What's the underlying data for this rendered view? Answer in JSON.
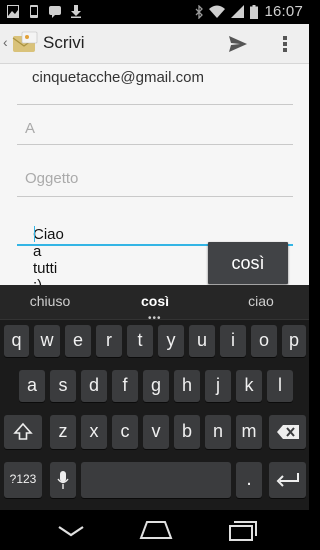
{
  "status_bar": {
    "time": "16:07"
  },
  "action_bar": {
    "title": "Scrivi"
  },
  "compose": {
    "from": "cinquetacche@gmail.com",
    "to_placeholder": "A",
    "subject_placeholder": "Oggetto",
    "body": "Ciao a tutti :)"
  },
  "suggestion_popup": "così",
  "keyboard": {
    "suggestions": [
      "chiuso",
      "così",
      "ciao"
    ],
    "row1": [
      "q",
      "w",
      "e",
      "r",
      "t",
      "y",
      "u",
      "i",
      "o",
      "p"
    ],
    "row2": [
      "a",
      "s",
      "d",
      "f",
      "g",
      "h",
      "j",
      "k",
      "l"
    ],
    "row3": [
      "z",
      "x",
      "c",
      "v",
      "b",
      "n",
      "m"
    ],
    "symbols_label": "?123",
    "period_label": "."
  }
}
